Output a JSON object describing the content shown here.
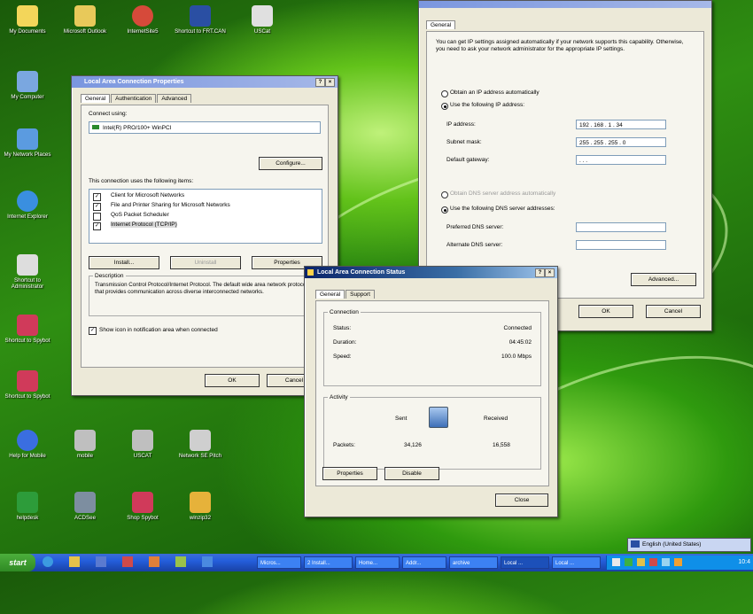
{
  "desktop": {
    "icons": [
      {
        "label": "My Documents"
      },
      {
        "label": "Microsoft Outlook"
      },
      {
        "label": "InternetSite5"
      },
      {
        "label": "Shortcut to FRT.CAN"
      },
      {
        "label": "USCat"
      },
      {
        "label": "My Computer"
      },
      {
        "label": "My Network Places"
      },
      {
        "label": "Internet Explorer"
      },
      {
        "label": "Shortcut to Administrator"
      },
      {
        "label": "Shortcut to Spybot"
      },
      {
        "label": "Shortcut to Spybot"
      },
      {
        "label": "Help for Mobile"
      },
      {
        "label": "mobile"
      },
      {
        "label": "USCAT"
      },
      {
        "label": "Network SE Pitch"
      },
      {
        "label": "helpdesk"
      },
      {
        "label": "ACDSee"
      },
      {
        "label": "Shop Spybot"
      },
      {
        "label": "winzip32"
      }
    ]
  },
  "colors": {
    "titlebar": "#0a246a",
    "taskbar": "#245edb",
    "start": "#3c9a2c"
  },
  "lac_props": {
    "title": "Local Area Connection Properties",
    "tabs": [
      "General",
      "Authentication",
      "Advanced"
    ],
    "connect_using_label": "Connect using:",
    "adapter": "Intel(R) PRO/100+ WinPCI",
    "configure": "Configure...",
    "items_label": "This connection uses the following items:",
    "items": [
      {
        "label": "Client for Microsoft Networks",
        "checked": true
      },
      {
        "label": "File and Printer Sharing for Microsoft Networks",
        "checked": true
      },
      {
        "label": "QoS Packet Scheduler",
        "checked": false
      },
      {
        "label": "Internet Protocol (TCP/IP)",
        "checked": true
      }
    ],
    "install": "Install...",
    "uninstall": "Uninstall",
    "properties": "Properties",
    "description_label": "Description",
    "description": "Transmission Control Protocol/Internet Protocol. The default wide area network protocol that provides communication across diverse interconnected networks.",
    "show_icon": "Show icon in notification area when connected",
    "ok": "OK",
    "cancel": "Cancel"
  },
  "tcpip": {
    "tab": "General",
    "intro": "You can get IP settings assigned automatically if your network supports this capability. Otherwise, you need to ask your network administrator for the appropriate IP settings.",
    "auto_ip": "Obtain an IP address automatically",
    "use_ip": "Use the following IP address:",
    "ip_label": "IP address:",
    "ip_value": "192 . 168 . 1 . 34",
    "mask_label": "Subnet mask:",
    "mask_value": "255 . 255 . 255 . 0",
    "gateway_label": "Default gateway:",
    "gateway_value": ". . .",
    "auto_dns": "Obtain DNS server address automatically",
    "use_dns": "Use the following DNS server addresses:",
    "pref_dns": "Preferred DNS server:",
    "alt_dns": "Alternate DNS server:",
    "advanced": "Advanced...",
    "ok": "OK",
    "cancel": "Cancel"
  },
  "status": {
    "title": "Local Area Connection Status",
    "tabs": [
      "General",
      "Support"
    ],
    "connection_label": "Connection",
    "status_label": "Status:",
    "status_value": "Connected",
    "duration_label": "Duration:",
    "duration_value": "04:45:02",
    "speed_label": "Speed:",
    "speed_value": "100.0 Mbps",
    "activity_label": "Activity",
    "sent": "Sent",
    "received": "Received",
    "packets_label": "Packets:",
    "packets_sent": "34,126",
    "packets_received": "16,558",
    "properties": "Properties",
    "disable": "Disable",
    "close": "Close"
  },
  "language_bar": {
    "label": "English (United States)"
  },
  "taskbar": {
    "start": "start",
    "buttons": [
      "Micros...",
      "2 Install...",
      "Home...",
      "Addr...",
      "archive",
      "Local ...",
      "Local ..."
    ],
    "clock": "10:4"
  }
}
